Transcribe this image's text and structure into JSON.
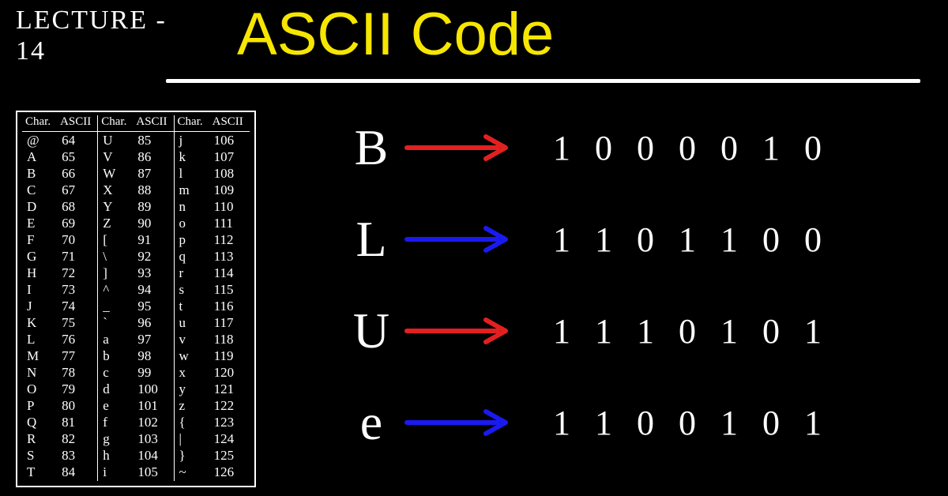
{
  "lecture_label": "LECTURE - 14",
  "title": "ASCII Code",
  "table": {
    "headers": [
      "Char.",
      "ASCII",
      "Char.",
      "ASCII",
      "Char.",
      "ASCII"
    ],
    "rows": [
      [
        "@",
        "64",
        "U",
        "85",
        "j",
        "106"
      ],
      [
        "A",
        "65",
        "V",
        "86",
        "k",
        "107"
      ],
      [
        "B",
        "66",
        "W",
        "87",
        "l",
        "108"
      ],
      [
        "C",
        "67",
        "X",
        "88",
        "m",
        "109"
      ],
      [
        "D",
        "68",
        "Y",
        "89",
        "n",
        "110"
      ],
      [
        "E",
        "69",
        "Z",
        "90",
        "o",
        "111"
      ],
      [
        "F",
        "70",
        "[",
        "91",
        "p",
        "112"
      ],
      [
        "G",
        "71",
        "\\",
        "92",
        "q",
        "113"
      ],
      [
        "H",
        "72",
        "]",
        "93",
        "r",
        "114"
      ],
      [
        "I",
        "73",
        "^",
        "94",
        "s",
        "115"
      ],
      [
        "J",
        "74",
        "_",
        "95",
        "t",
        "116"
      ],
      [
        "K",
        "75",
        "`",
        "96",
        "u",
        "117"
      ],
      [
        "L",
        "76",
        "a",
        "97",
        "v",
        "118"
      ],
      [
        "M",
        "77",
        "b",
        "98",
        "w",
        "119"
      ],
      [
        "N",
        "78",
        "c",
        "99",
        "x",
        "120"
      ],
      [
        "O",
        "79",
        "d",
        "100",
        "y",
        "121"
      ],
      [
        "P",
        "80",
        "e",
        "101",
        "z",
        "122"
      ],
      [
        "Q",
        "81",
        "f",
        "102",
        "{",
        "123"
      ],
      [
        "R",
        "82",
        "g",
        "103",
        "|",
        "124"
      ],
      [
        "S",
        "83",
        "h",
        "104",
        "}",
        "125"
      ],
      [
        "T",
        "84",
        "i",
        "105",
        "~",
        "126"
      ]
    ]
  },
  "examples": [
    {
      "char": "B",
      "binary": "1000010",
      "arrow_color": "#e32020"
    },
    {
      "char": "L",
      "binary": "1101100",
      "arrow_color": "#1a1af0"
    },
    {
      "char": "U",
      "binary": "1110101",
      "arrow_color": "#e32020"
    },
    {
      "char": "e",
      "binary": "1100101",
      "arrow_color": "#1a1af0"
    }
  ]
}
